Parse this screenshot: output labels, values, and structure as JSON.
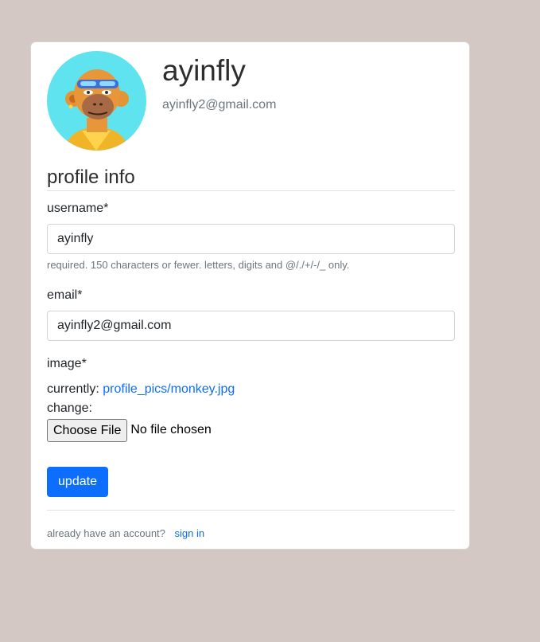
{
  "profile": {
    "name": "ayinfly",
    "email": "ayinfly2@gmail.com"
  },
  "form": {
    "section_title": "profile info",
    "username_label": "username*",
    "username_value": "ayinfly",
    "username_help": "required. 150 characters or fewer. letters, digits and @/./+/-/_ only.",
    "email_label": "email*",
    "email_value": "ayinfly2@gmail.com",
    "image_label": "image*",
    "currently_label": "currently:",
    "current_file": "profile_pics/monkey.jpg",
    "change_label": "change:",
    "choose_file_label": "Choose File",
    "no_file_text": "No file chosen",
    "submit_label": "update"
  },
  "footer": {
    "prompt": "already have an account?",
    "signin_label": "sign in"
  },
  "colors": {
    "page_bg": "#d3c8c3",
    "primary": "#0d6efd",
    "avatar_bg": "#5fe3ef"
  },
  "icons": {
    "avatar": "ape-avatar-image"
  }
}
